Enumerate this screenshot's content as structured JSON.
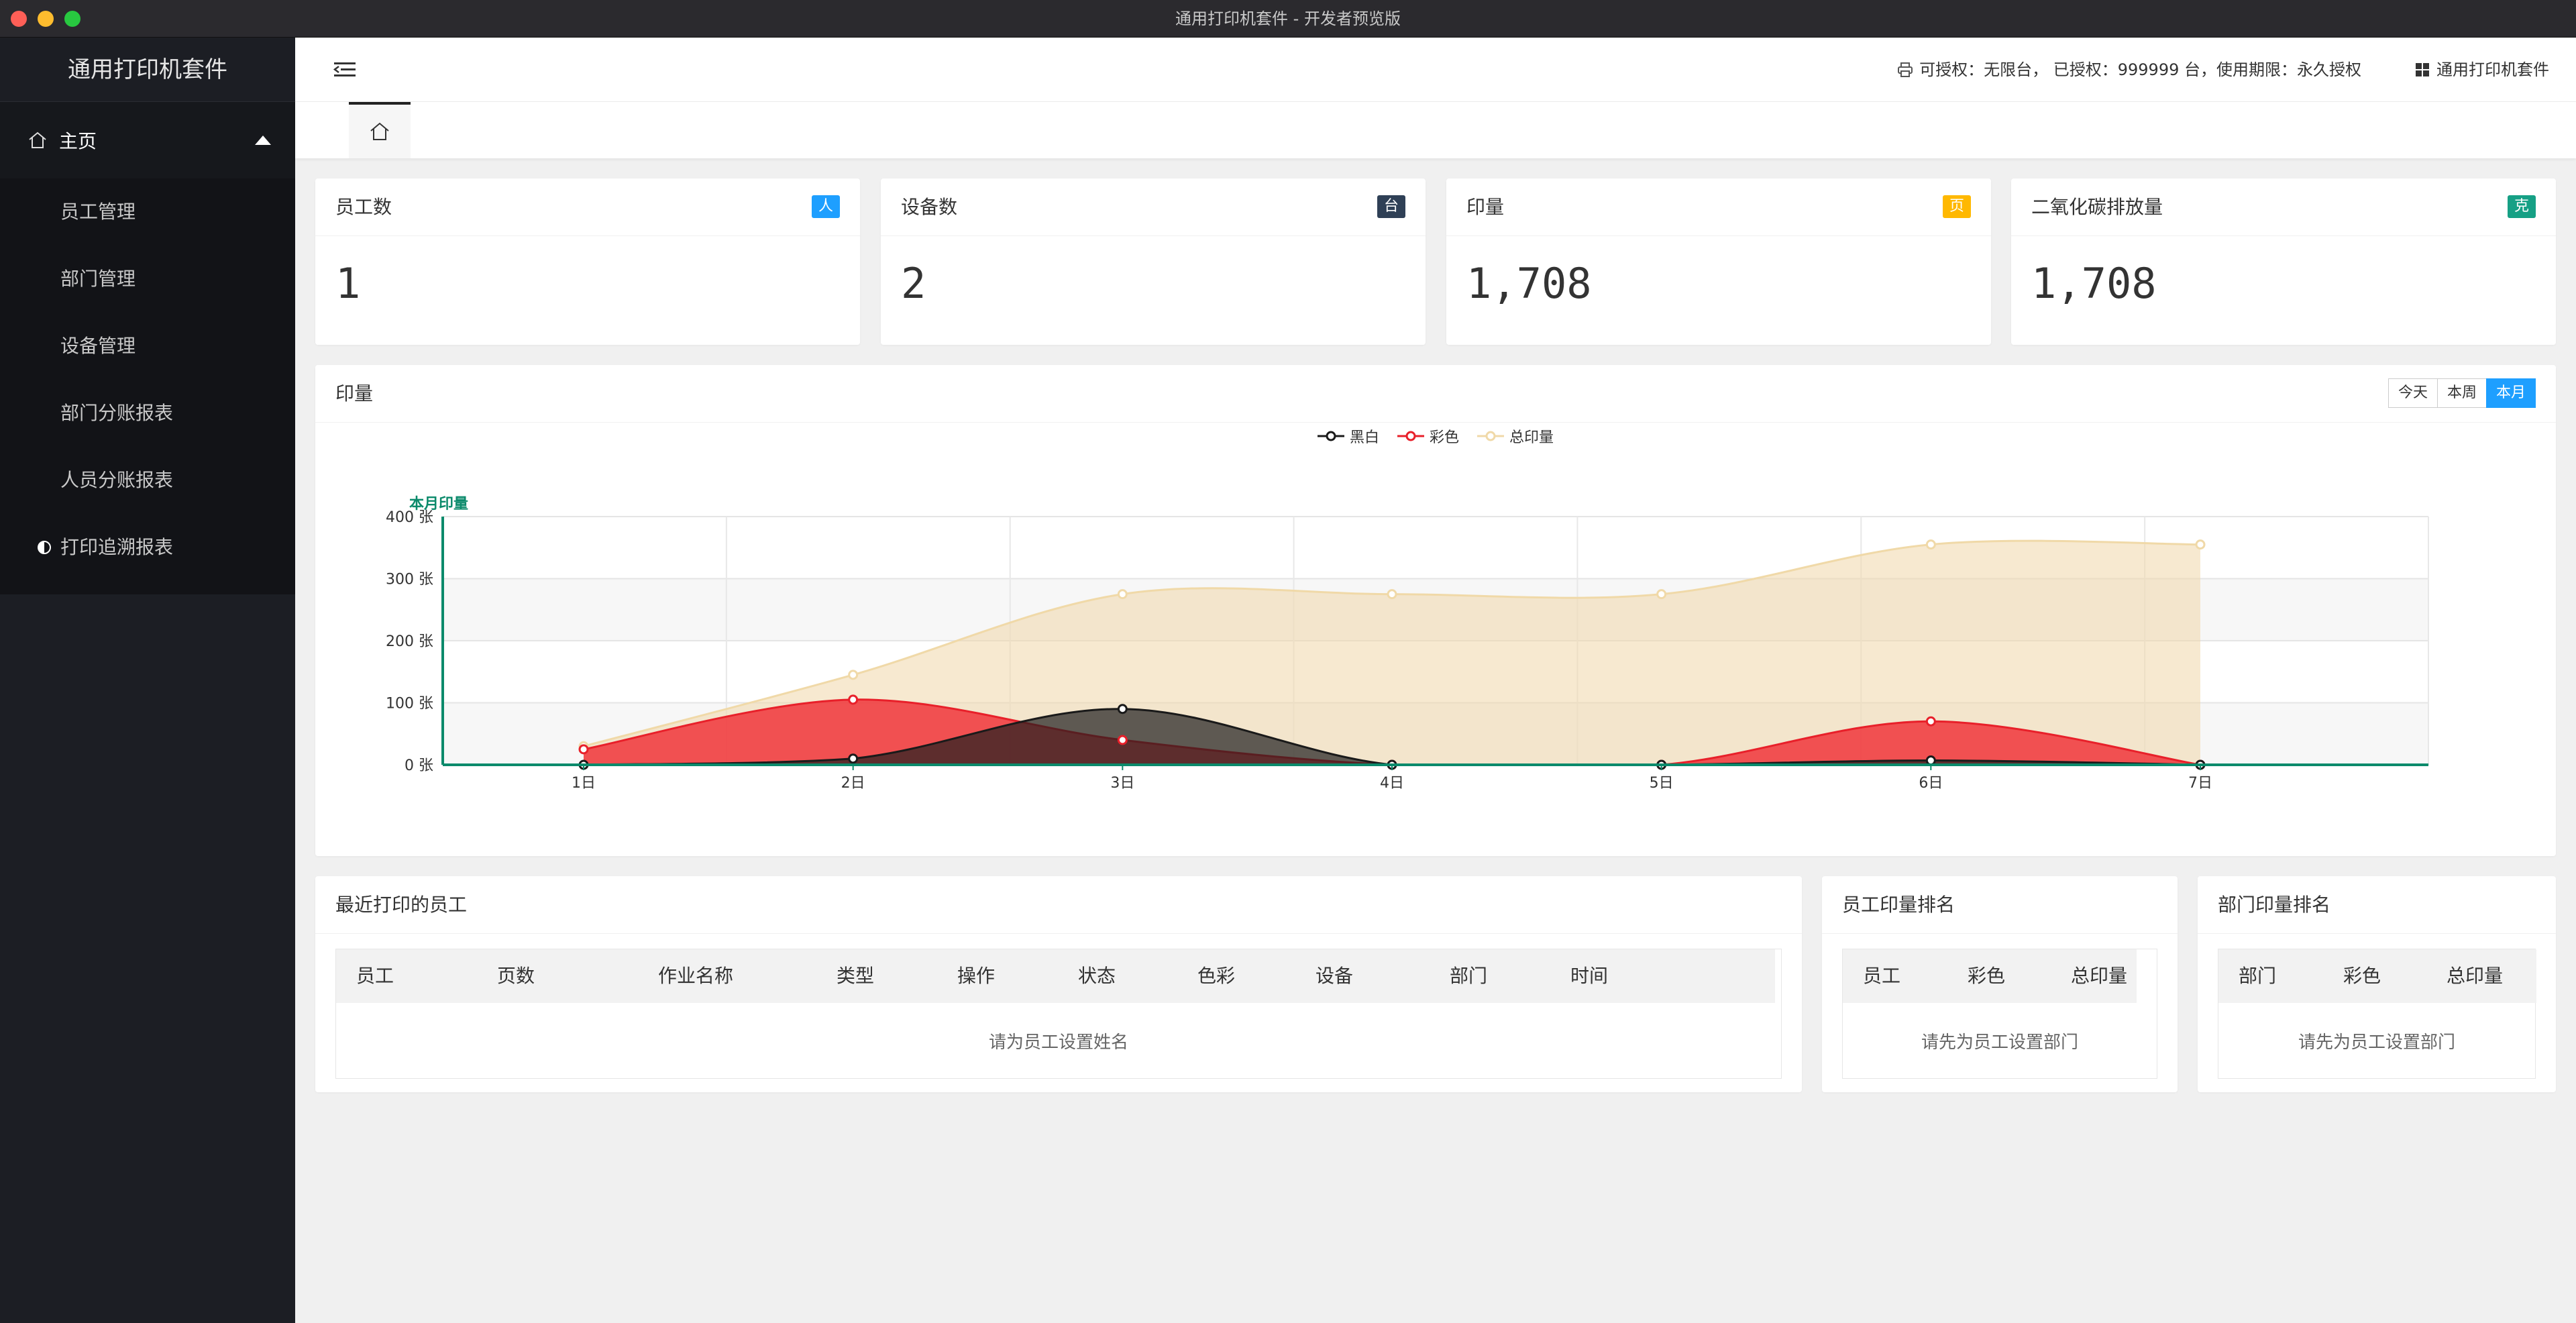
{
  "window": {
    "title": "通用打印机套件 - 开发者预览版"
  },
  "sidebar": {
    "brand": "通用打印机套件",
    "home_label": "主页",
    "items": [
      {
        "label": "员工管理"
      },
      {
        "label": "部门管理"
      },
      {
        "label": "设备管理"
      },
      {
        "label": "部门分账报表"
      },
      {
        "label": "人员分账报表"
      },
      {
        "label": "打印追溯报表"
      }
    ]
  },
  "header": {
    "license_text": "可授权：无限台， 已授权：999999 台，使用期限：永久授权",
    "app_name": "通用打印机套件"
  },
  "stats": [
    {
      "title": "员工数",
      "badge": "人",
      "badge_color": "#1e9fff",
      "value": "1"
    },
    {
      "title": "设备数",
      "badge": "台",
      "badge_color": "#2f4056",
      "value": "2"
    },
    {
      "title": "印量",
      "badge": "页",
      "badge_color": "#ffb800",
      "value": "1,708"
    },
    {
      "title": "二氧化碳排放量",
      "badge": "克",
      "badge_color": "#16a085",
      "value": "1,708"
    }
  ],
  "print_chart": {
    "title": "印量",
    "ranges": [
      "今天",
      "本周",
      "本月"
    ],
    "active_range": "本月"
  },
  "chart_data": {
    "type": "area",
    "ylabel": "本月印量",
    "categories": [
      "1日",
      "2日",
      "3日",
      "4日",
      "5日",
      "6日",
      "7日"
    ],
    "ylim": [
      0,
      400
    ],
    "yticks": [
      "0 张",
      "100 张",
      "200 张",
      "300 张",
      "400 张"
    ],
    "grid": true,
    "legend": "top-center",
    "series": [
      {
        "name": "黑白",
        "color": "#1a1a1a",
        "values": [
          0,
          10,
          90,
          0,
          0,
          7,
          0
        ]
      },
      {
        "name": "彩色",
        "color": "#e8202a",
        "values": [
          25,
          105,
          40,
          0,
          0,
          70,
          0
        ]
      },
      {
        "name": "总印量",
        "color": "#f0d9a8",
        "values": [
          30,
          145,
          275,
          275,
          275,
          355,
          355
        ]
      }
    ]
  },
  "recent": {
    "title": "最近打印的员工",
    "columns": [
      "员工",
      "页数",
      "作业名称",
      "类型",
      "操作",
      "状态",
      "色彩",
      "设备",
      "部门",
      "时间"
    ],
    "empty": "请为员工设置姓名"
  },
  "emp_rank": {
    "title": "员工印量排名",
    "columns": [
      "员工",
      "彩色",
      "总印量"
    ],
    "empty": "请先为员工设置部门"
  },
  "dept_rank": {
    "title": "部门印量排名",
    "columns": [
      "部门",
      "彩色",
      "总印量"
    ],
    "empty": "请先为员工设置部门"
  }
}
